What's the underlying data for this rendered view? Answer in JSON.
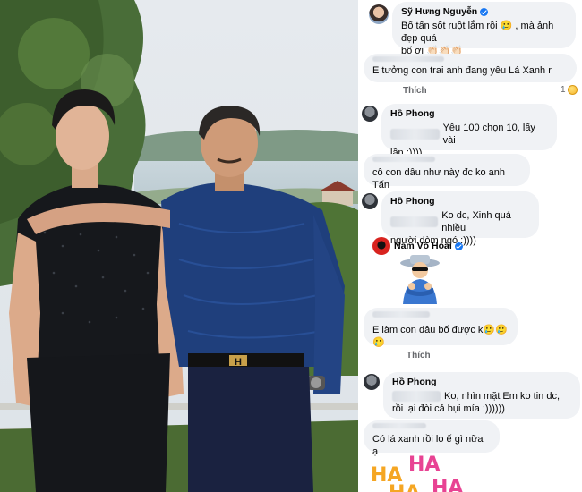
{
  "photo": {
    "belt_letter": "H"
  },
  "comments": [
    {
      "id": "c1",
      "author": "Sỹ Hưng Nguyễn",
      "verified": true,
      "line1": "Bố tấn sốt ruột lắm rồi 🥲 , mà ảnh đẹp quá",
      "line2": "bố ơi 👏🏻👏🏻👏🏻"
    },
    {
      "id": "c2",
      "author": "",
      "text": "E tưởng con trai anh đang yêu Lá Xanh r",
      "action": "Thích",
      "reaction_count": "1"
    },
    {
      "id": "c3",
      "author": "Hồ Phong",
      "line1": "Yêu 100 chọn 10, lấy vài",
      "line2": "lần :))))"
    },
    {
      "id": "c4",
      "author": "",
      "text": "cô con dâu như này đc ko  anh Tấn"
    },
    {
      "id": "c5",
      "author": "Hồ Phong",
      "line1": "Ko dc, Xinh quá nhiều",
      "line2": "người dòm ngó :))))"
    },
    {
      "id": "c6",
      "author": "Nam Võ Hoài",
      "verified": true,
      "sticker": "man-in-hat-sticker"
    },
    {
      "id": "c7",
      "author": "",
      "text": "E làm con dâu bố được k🥲🥲🥲",
      "action": "Thích"
    },
    {
      "id": "c8",
      "author": "Hồ Phong",
      "line1": "Ko, nhìn mặt Em ko tin dc,",
      "line2": "rồi lại đòi cả bụi mía :))))))"
    },
    {
      "id": "c9",
      "author": "",
      "text": "Có lá xanh rồi lo ế gì nữa ạ"
    }
  ],
  "haha_sticker": {
    "words": [
      "HA",
      "HA",
      "HA",
      "HA"
    ],
    "colors": [
      "#f5a623",
      "#e84393",
      "#f5a623",
      "#e84393"
    ]
  }
}
